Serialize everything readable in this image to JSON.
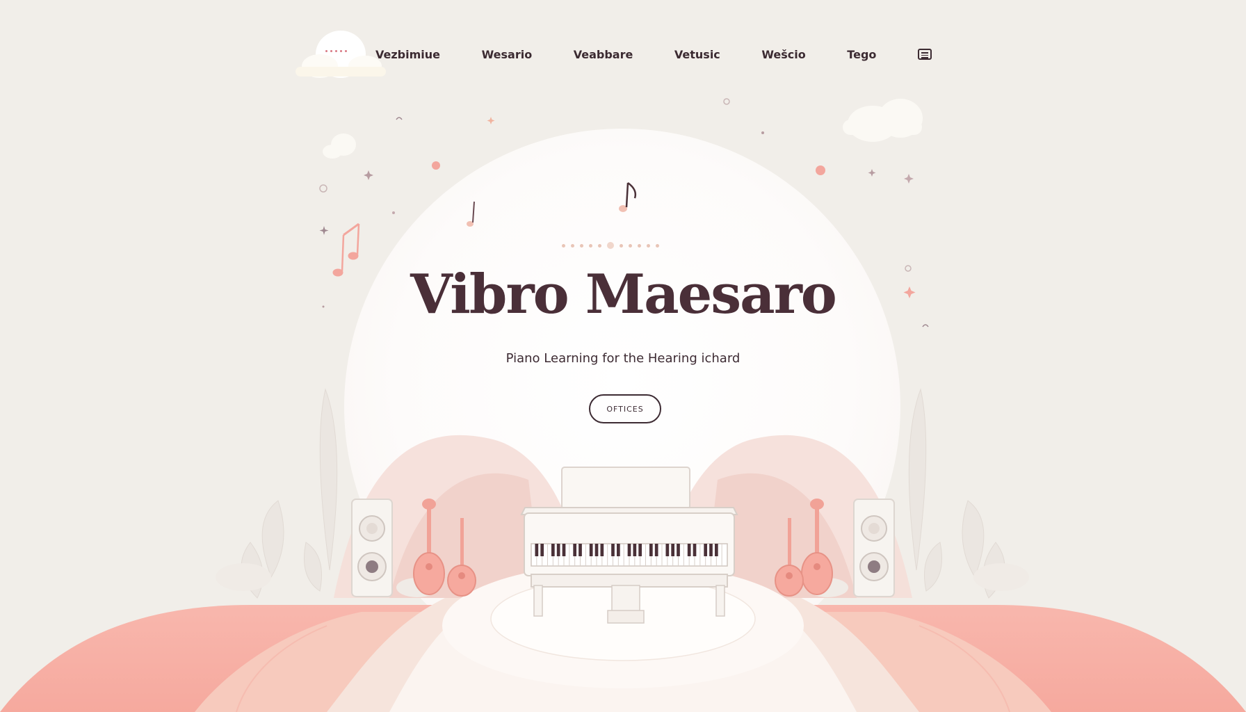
{
  "nav": {
    "items": [
      "Vezbimiue",
      "Wesario",
      "Veabbare",
      "Vetusic",
      "Wešcio",
      "Tego"
    ],
    "menu_icon": "menu-icon"
  },
  "hero": {
    "title": "Vibro Maesaro",
    "subtitle": "Piano Learning for the Hearing ichard",
    "cta_label": "OFTICES"
  },
  "colors": {
    "background": "#f1eee9",
    "accent_pink": "#f5a8a0",
    "text_dark": "#3d2b33",
    "hero_circle": "#ffffff"
  },
  "icons": {
    "logo": "cloud-logo-icon",
    "notes": "music-note-icon",
    "piano": "grand-piano-icon",
    "speaker": "speaker-icon",
    "guitar": "guitar-icon"
  }
}
